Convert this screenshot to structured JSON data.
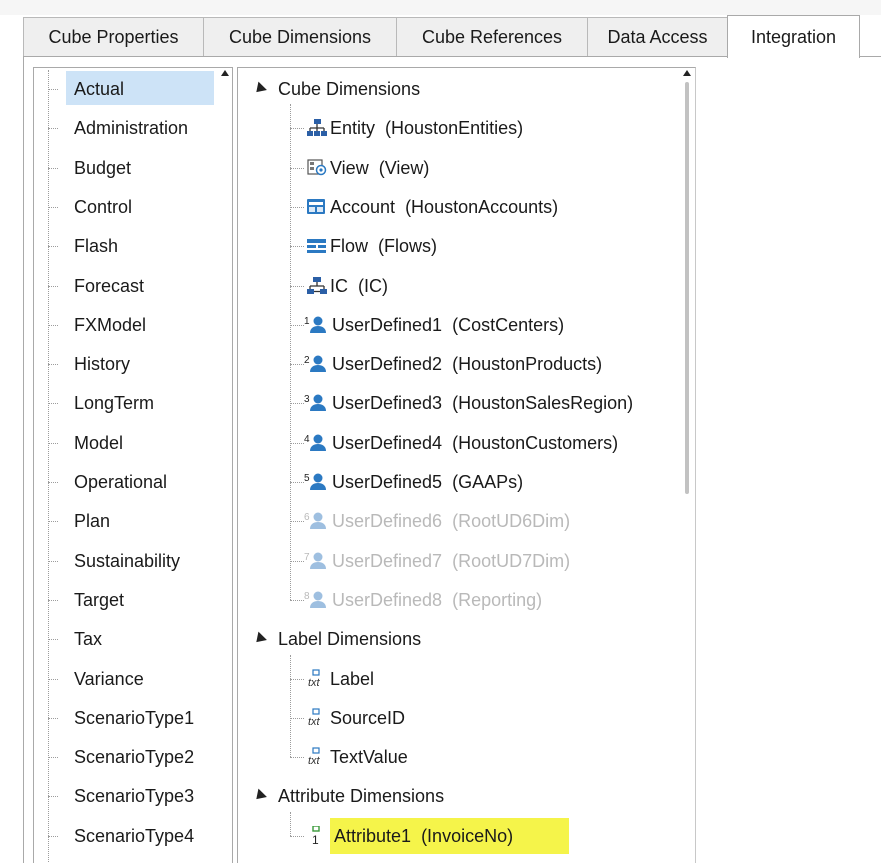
{
  "tabs": [
    {
      "label": "Cube Properties"
    },
    {
      "label": "Cube Dimensions"
    },
    {
      "label": "Cube References"
    },
    {
      "label": "Data Access"
    },
    {
      "label": "Integration"
    }
  ],
  "active_tab_index": 4,
  "scenario_types": [
    "Actual",
    "Administration",
    "Budget",
    "Control",
    "Flash",
    "Forecast",
    "FXModel",
    "History",
    "LongTerm",
    "Model",
    "Operational",
    "Plan",
    "Sustainability",
    "Target",
    "Tax",
    "Variance",
    "ScenarioType1",
    "ScenarioType2",
    "ScenarioType3",
    "ScenarioType4"
  ],
  "selected_scenario": "Actual",
  "tree": {
    "cube_dimensions": {
      "label": "Cube Dimensions",
      "items": [
        {
          "name": "Entity",
          "value": "(HoustonEntities)",
          "icon": "entity-icon",
          "enabled": true
        },
        {
          "name": "View",
          "value": "(View)",
          "icon": "view-icon",
          "enabled": true
        },
        {
          "name": "Account",
          "value": "(HoustonAccounts)",
          "icon": "account-icon",
          "enabled": true
        },
        {
          "name": "Flow",
          "value": "(Flows)",
          "icon": "flow-icon",
          "enabled": true
        },
        {
          "name": "IC",
          "value": "(IC)",
          "icon": "ic-icon",
          "enabled": true
        },
        {
          "name": "UserDefined1",
          "value": "(CostCenters)",
          "icon": "ud-icon",
          "badge": "1",
          "enabled": true
        },
        {
          "name": "UserDefined2",
          "value": "(HoustonProducts)",
          "icon": "ud-icon",
          "badge": "2",
          "enabled": true
        },
        {
          "name": "UserDefined3",
          "value": "(HoustonSalesRegion)",
          "icon": "ud-icon",
          "badge": "3",
          "enabled": true
        },
        {
          "name": "UserDefined4",
          "value": "(HoustonCustomers)",
          "icon": "ud-icon",
          "badge": "4",
          "enabled": true
        },
        {
          "name": "UserDefined5",
          "value": "(GAAPs)",
          "icon": "ud-icon",
          "badge": "5",
          "enabled": true
        },
        {
          "name": "UserDefined6",
          "value": "(RootUD6Dim)",
          "icon": "ud-icon",
          "badge": "6",
          "enabled": false
        },
        {
          "name": "UserDefined7",
          "value": "(RootUD7Dim)",
          "icon": "ud-icon",
          "badge": "7",
          "enabled": false
        },
        {
          "name": "UserDefined8",
          "value": "(Reporting)",
          "icon": "ud-icon",
          "badge": "8",
          "enabled": false
        }
      ]
    },
    "label_dimensions": {
      "label": "Label Dimensions",
      "items": [
        {
          "name": "Label",
          "icon": "txt-icon"
        },
        {
          "name": "SourceID",
          "icon": "txt-icon"
        },
        {
          "name": "TextValue",
          "icon": "txt-icon"
        }
      ]
    },
    "attribute_dimensions": {
      "label": "Attribute Dimensions",
      "items": [
        {
          "name": "Attribute1",
          "value": "(InvoiceNo)",
          "icon": "attribute-icon",
          "badge": "1",
          "highlighted": true
        }
      ]
    }
  },
  "colors": {
    "selection": "#cde3f7",
    "highlight": "#f5f44a",
    "disabled_text": "#b9b9b9",
    "ud_icon_blue": "#2b79c2"
  }
}
